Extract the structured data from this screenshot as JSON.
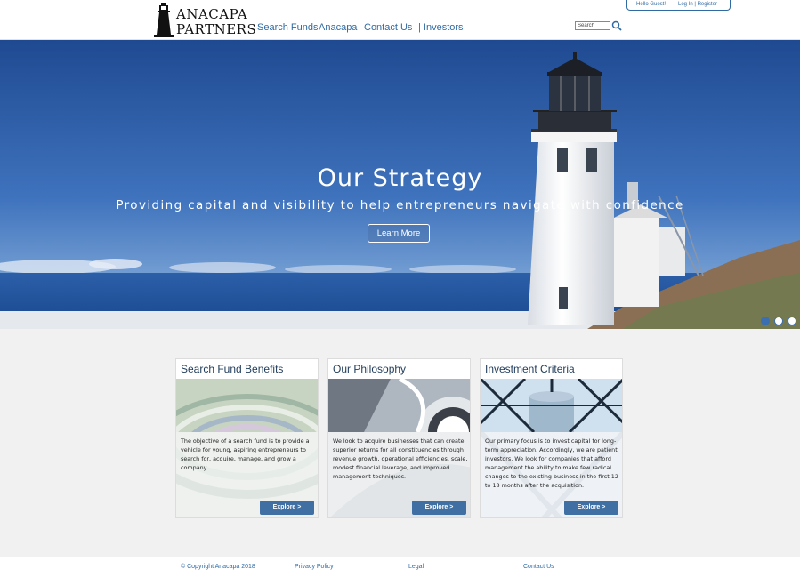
{
  "brand": {
    "name_line1": "ANACAPA",
    "name_line2": "PARTNERS"
  },
  "nav": {
    "items": [
      {
        "label": "Search Funds"
      },
      {
        "label": "Anacapa"
      },
      {
        "label": "Contact Us"
      },
      {
        "label": "| Investors"
      }
    ]
  },
  "search": {
    "placeholder": "Search",
    "icon": "search-icon"
  },
  "account": {
    "greeting": "Hello Guest!",
    "login": "Log In | Register"
  },
  "hero": {
    "title": "Our Strategy",
    "subtitle": "Providing capital and visibility to help entrepreneurs navigate with confidence",
    "button": "Learn More",
    "slides": 3,
    "active_slide": 1
  },
  "cards": [
    {
      "title": "Search Fund Benefits",
      "text": "The objective of a search fund is to provide a vehicle for young, aspiring entrepreneurs to search for, acquire, manage, and grow a company.",
      "button": "Explore >"
    },
    {
      "title": "Our Philosophy",
      "text": "We look to acquire businesses that can create superior returns for all constituencies through revenue growth, operational efficiencies, scale, modest financial leverage, and improved management techniques.",
      "button": "Explore >"
    },
    {
      "title": "Investment Criteria",
      "text": "Our primary focus is to invest capital for long-term appreciation. Accordingly, we are patient investors. We look for companies that afford management the ability to make few radical changes to the existing business in the first 12 to 18 months after the acquisition.",
      "button": "Explore >"
    }
  ],
  "footer": {
    "copyright": "© Copyright Anacapa 2018",
    "privacy": "Privacy Policy",
    "legal": "Legal",
    "contact": "Contact Us"
  },
  "colors": {
    "accent": "#2f6aa3",
    "button": "#3f6fa3",
    "sky": "#3566b0"
  }
}
